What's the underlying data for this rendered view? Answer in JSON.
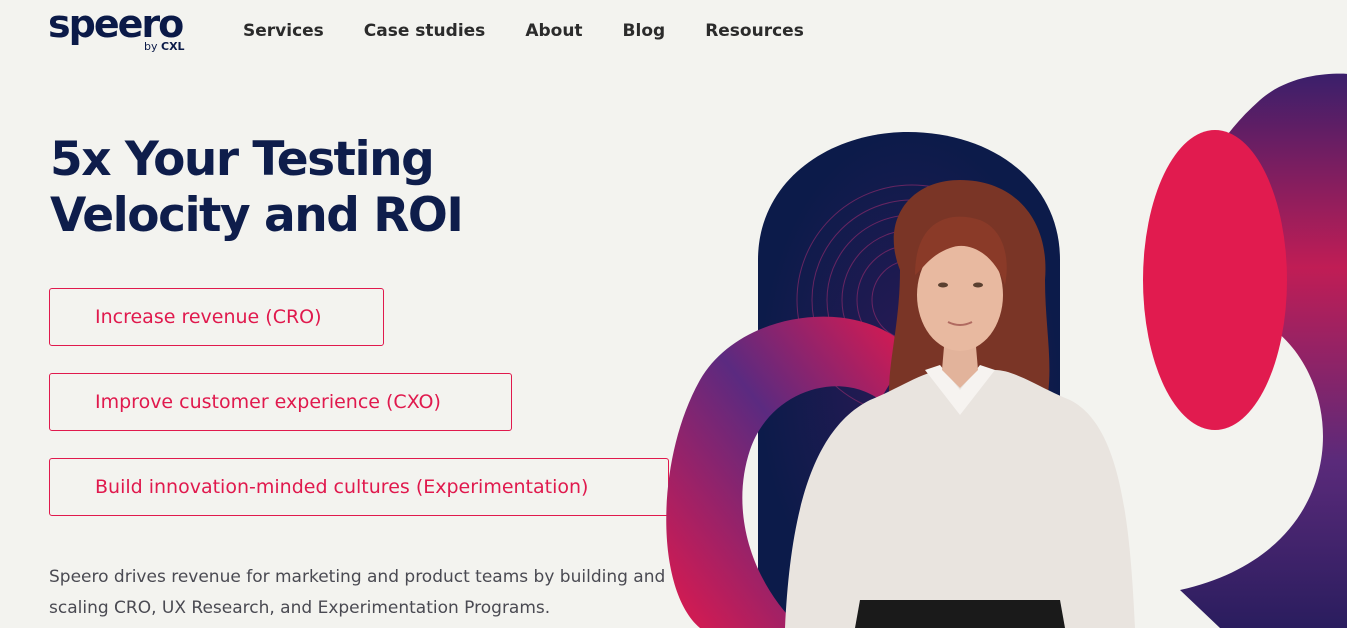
{
  "logo": {
    "word": "speero",
    "by": "by",
    "brand": "CXL"
  },
  "nav": {
    "items": [
      {
        "label": "Services"
      },
      {
        "label": "Case studies"
      },
      {
        "label": "About"
      },
      {
        "label": "Blog"
      },
      {
        "label": "Resources"
      }
    ]
  },
  "hero": {
    "title_line1": "5x Your Testing",
    "title_line2": "Velocity and ROI",
    "buttons": [
      {
        "label": "Increase revenue (CRO)"
      },
      {
        "label": "Improve customer experience (CXO)"
      },
      {
        "label": "Build innovation-minded cultures (Experimentation)"
      }
    ],
    "description": "Speero drives revenue for marketing and product teams by building and scaling CRO, UX Research, and Experimentation Programs."
  },
  "colors": {
    "accent": "#e0194d",
    "navy": "#0e1d4b",
    "background": "#f3f3ef"
  },
  "icons": {
    "hero_visual": "person-with-ribbon-graphic"
  }
}
